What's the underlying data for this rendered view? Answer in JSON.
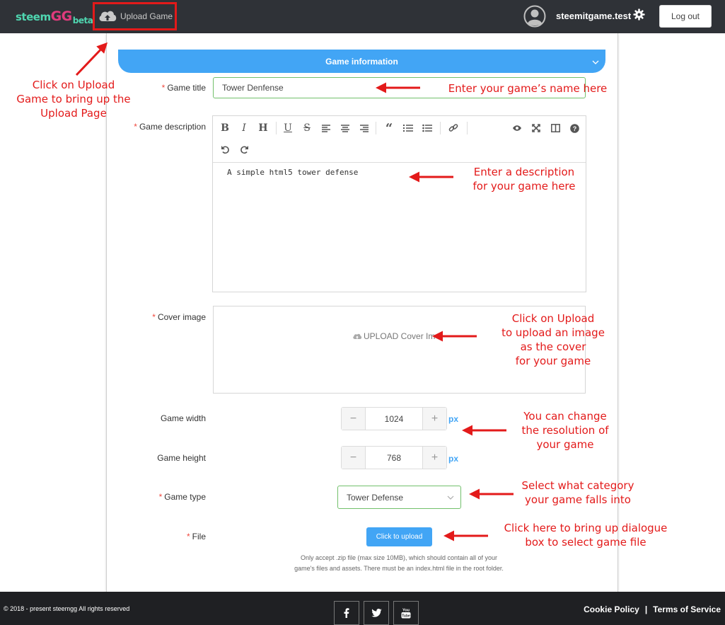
{
  "header": {
    "logo": {
      "part1": "steem",
      "part2": "GG",
      "part3": "beta"
    },
    "upload_game_label": "Upload Game",
    "username": "steemitgame.test",
    "logout_label": "Log out"
  },
  "form": {
    "section_title": "Game information",
    "game_title_label": "Game title",
    "game_title_value": "Tower Denfense",
    "game_description_label": "Game description",
    "game_description_value": "A simple html5 tower defense",
    "editor_toolbar": [
      "bold",
      "italic",
      "heading",
      "underline",
      "strikethrough",
      "align-left",
      "align-center",
      "align-right",
      "quote",
      "ordered-list",
      "unordered-list",
      "link",
      "preview",
      "fullscreen",
      "side-by-side",
      "help",
      "undo",
      "redo"
    ],
    "cover_image_label": "Cover image",
    "cover_upload_text": "UPLOAD Cover Im",
    "game_width_label": "Game width",
    "game_width_value": "1024",
    "game_height_label": "Game height",
    "game_height_value": "768",
    "unit": "px",
    "minus": "−",
    "plus": "+",
    "game_type_label": "Game type",
    "game_type_value": "Tower Defense",
    "file_label": "File",
    "upload_button_label": "Click to upload",
    "file_hint_line1": "Only accept .zip file (max size 10MB), which should contain all of your",
    "file_hint_line2": "game's files and assets. There must be an index.html file in the root folder.",
    "required_mark": "*"
  },
  "footer": {
    "copyright": "© 2018 - present steemgg All rights reserved",
    "cookie_policy": "Cookie Policy",
    "separator": "|",
    "terms": "Terms of Service",
    "social": [
      "facebook",
      "twitter",
      "youtube"
    ]
  },
  "annotations": {
    "upload_nav": [
      "Click on Upload",
      "Game to bring up the",
      "Upload Page"
    ],
    "title": [
      "Enter your game’s name here"
    ],
    "description": [
      "Enter a description",
      "for your game here"
    ],
    "cover": [
      "Click on Upload",
      "to upload an image",
      "as the cover",
      "for your game"
    ],
    "resolution": [
      "You can change",
      "the resolution of",
      "your game"
    ],
    "category": [
      "Select what category",
      "your game falls into"
    ],
    "file": [
      "Click here to bring up dialogue",
      "box to select game file"
    ]
  },
  "colors": {
    "header_bg": "#2f3237",
    "accent": "#42a5f5",
    "valid_border": "#72c06b",
    "required": "#f0483e",
    "annotation": "#e31a1a",
    "footer_bg": "#1f2023"
  }
}
